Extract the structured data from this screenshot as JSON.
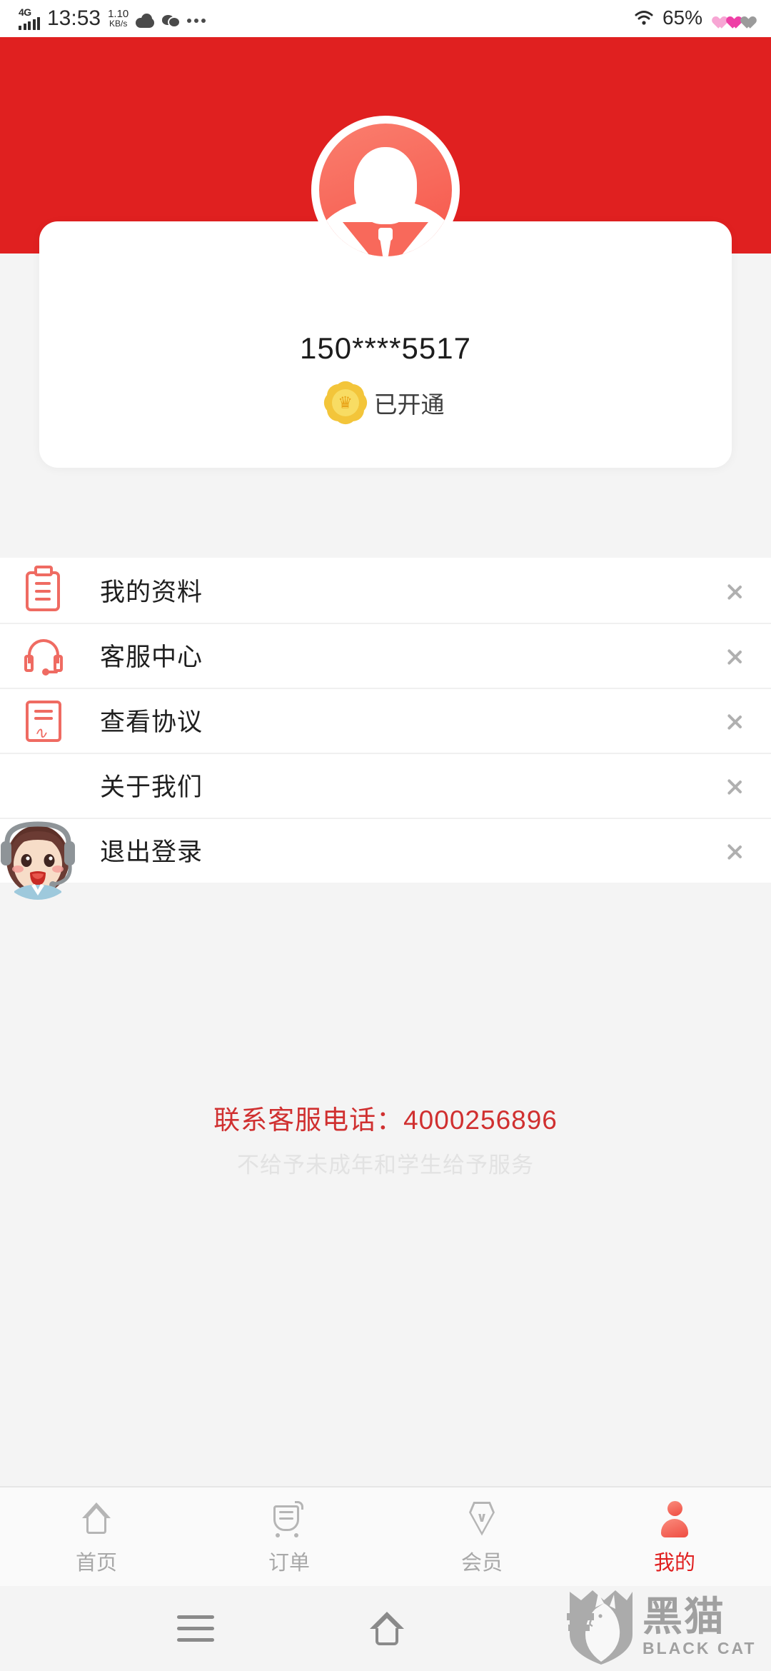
{
  "status_bar": {
    "network_type": "4G",
    "time": "13:53",
    "data_rate_value": "1.10",
    "data_rate_unit": "KB/s",
    "battery": "65%",
    "icons": [
      "signal-bars-icon",
      "cloud-icon",
      "wechat-icon",
      "more-dots-icon",
      "wifi-icon",
      "heart-icon"
    ]
  },
  "profile": {
    "avatar_icon": "user-avatar-icon",
    "phone": "150****5517",
    "vip_badge_icon": "crown-badge-icon",
    "vip_status": "已开通"
  },
  "menu": {
    "items": [
      {
        "label": "我的资料",
        "icon": "clipboard-icon"
      },
      {
        "label": "客服中心",
        "icon": "headset-icon"
      },
      {
        "label": "查看协议",
        "icon": "agreement-document-icon"
      },
      {
        "label": "关于我们",
        "icon": "info-icon"
      },
      {
        "label": "退出登录",
        "icon": "logout-icon"
      }
    ],
    "chevron_icon": "chevron-right-icon"
  },
  "service_float": {
    "icon": "customer-service-avatar-icon"
  },
  "contact": {
    "line": "联系客服电话：4000256896",
    "note": "不给予未成年和学生给予服务"
  },
  "tabbar": {
    "tabs": [
      {
        "label": "首页",
        "icon": "home-icon",
        "active": false
      },
      {
        "label": "订单",
        "icon": "order-cart-icon",
        "active": false
      },
      {
        "label": "会员",
        "icon": "member-diamond-icon",
        "active": false
      },
      {
        "label": "我的",
        "icon": "profile-person-icon",
        "active": true
      }
    ]
  },
  "system_nav": {
    "menu_icon": "hamburger-menu-icon",
    "home_icon": "home-nav-icon"
  },
  "watermark": {
    "cn": "黑猫",
    "en": "BLACK CAT",
    "icon": "black-cat-shield-icon"
  },
  "colors": {
    "brand_red": "#e02020",
    "icon_red": "#ef6b62",
    "contact_red": "#d03030",
    "badge_gold": "#f3c53a",
    "tab_inactive": "#a8a8a8"
  }
}
